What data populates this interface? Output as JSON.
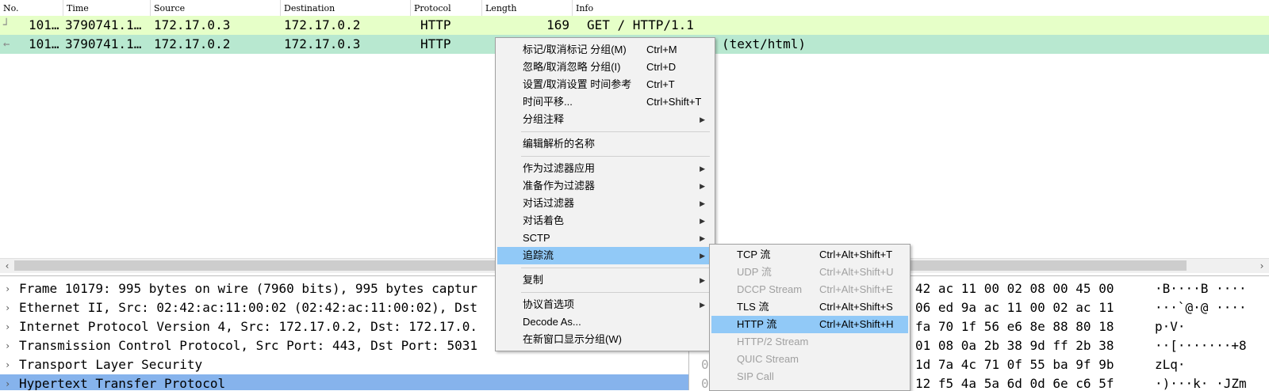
{
  "packet_list": {
    "columns": [
      "No.",
      "Time",
      "Source",
      "Destination",
      "Protocol",
      "Length",
      "Info"
    ],
    "rows": [
      {
        "no": "101…",
        "time": "3790741.1…",
        "src": "172.17.0.3",
        "dst": "172.17.0.2",
        "proto": "HTTP",
        "len": "169",
        "info": "GET / HTTP/1.1"
      },
      {
        "no": "101…",
        "time": "3790741.1…",
        "src": "172.17.0.2",
        "dst": "172.17.0.3",
        "proto": "HTTP",
        "len": "",
        "info": "(text/html)"
      }
    ]
  },
  "details": [
    "Frame 10179: 995 bytes on wire (7960 bits), 995 bytes captur",
    "Ethernet II, Src: 02:42:ac:11:00:02 (02:42:ac:11:00:02), Dst",
    "Internet Protocol Version 4, Src: 172.17.0.2, Dst: 172.17.0.",
    "Transmission Control Protocol, Src Port: 443, Dst Port: 5031",
    "Transport Layer Security",
    "Hypertext Transfer Protocol"
  ],
  "bytes": [
    {
      "off": "",
      "hex": "42 ac 11 00 02 08 00 45 00",
      "ascii": "·B····B ····"
    },
    {
      "off": "",
      "hex": "06 ed 9a ac 11 00 02 ac 11",
      "ascii": "···`@·@ ····"
    },
    {
      "off": "",
      "hex": "fa 70 1f 56 e6 8e 88 80 18",
      "ascii": "        p·V·"
    },
    {
      "off": "0",
      "hex": "01 08 0a 2b 38 9d ff 2b 38",
      "ascii": "··[·······+8"
    },
    {
      "off": "0",
      "hex": "1d 7a 4c 71 0f 55 ba 9f 9b",
      "ascii": "        zLq·"
    },
    {
      "off": "0",
      "hex": "12 f5 4a 5a 6d 0d 6e c6 5f",
      "ascii": "·)···k·  ·JZm"
    }
  ],
  "context_menu": {
    "items": [
      {
        "label": "标记/取消标记 分组(M)",
        "shortcut": "Ctrl+M",
        "submenu": false
      },
      {
        "label": "忽略/取消忽略 分组(I)",
        "shortcut": "Ctrl+D",
        "submenu": false
      },
      {
        "label": "设置/取消设置 时间参考",
        "shortcut": "Ctrl+T",
        "submenu": false
      },
      {
        "label": "时间平移...",
        "shortcut": "Ctrl+Shift+T",
        "submenu": false
      },
      {
        "label": "分组注释",
        "shortcut": "",
        "submenu": true
      },
      {
        "label": "编辑解析的名称",
        "shortcut": "",
        "submenu": false
      },
      {
        "label": "作为过滤器应用",
        "shortcut": "",
        "submenu": true
      },
      {
        "label": "准备作为过滤器",
        "shortcut": "",
        "submenu": true
      },
      {
        "label": "对话过滤器",
        "shortcut": "",
        "submenu": true
      },
      {
        "label": "对话着色",
        "shortcut": "",
        "submenu": true
      },
      {
        "label": "SCTP",
        "shortcut": "",
        "submenu": true
      },
      {
        "label": "追踪流",
        "shortcut": "",
        "submenu": true
      },
      {
        "label": "复制",
        "shortcut": "",
        "submenu": true
      },
      {
        "label": "协议首选项",
        "shortcut": "",
        "submenu": true
      },
      {
        "label": "Decode As...",
        "shortcut": "",
        "submenu": false
      },
      {
        "label": "在新窗口显示分组(W)",
        "shortcut": "",
        "submenu": false
      }
    ]
  },
  "follow_submenu": {
    "items": [
      {
        "label": "TCP 流",
        "shortcut": "Ctrl+Alt+Shift+T",
        "enabled": true
      },
      {
        "label": "UDP 流",
        "shortcut": "Ctrl+Alt+Shift+U",
        "enabled": false
      },
      {
        "label": "DCCP Stream",
        "shortcut": "Ctrl+Alt+Shift+E",
        "enabled": false
      },
      {
        "label": "TLS 流",
        "shortcut": "Ctrl+Alt+Shift+S",
        "enabled": true
      },
      {
        "label": "HTTP 流",
        "shortcut": "Ctrl+Alt+Shift+H",
        "enabled": true
      },
      {
        "label": "HTTP/2 Stream",
        "shortcut": "",
        "enabled": false
      },
      {
        "label": "QUIC Stream",
        "shortcut": "",
        "enabled": false
      },
      {
        "label": "SIP Call",
        "shortcut": "",
        "enabled": false
      }
    ]
  },
  "colors": {
    "request_row": "#e6ffc8",
    "response_row": "#b8e8d0",
    "selection": "#86b3ec",
    "menu_highlight": "#91c9f7"
  },
  "icons": {
    "scroll_left": "◀-arrow",
    "scroll_right": "▶-arrow",
    "expand": "collapsed-arrow",
    "submenu": "submenu-arrow"
  }
}
